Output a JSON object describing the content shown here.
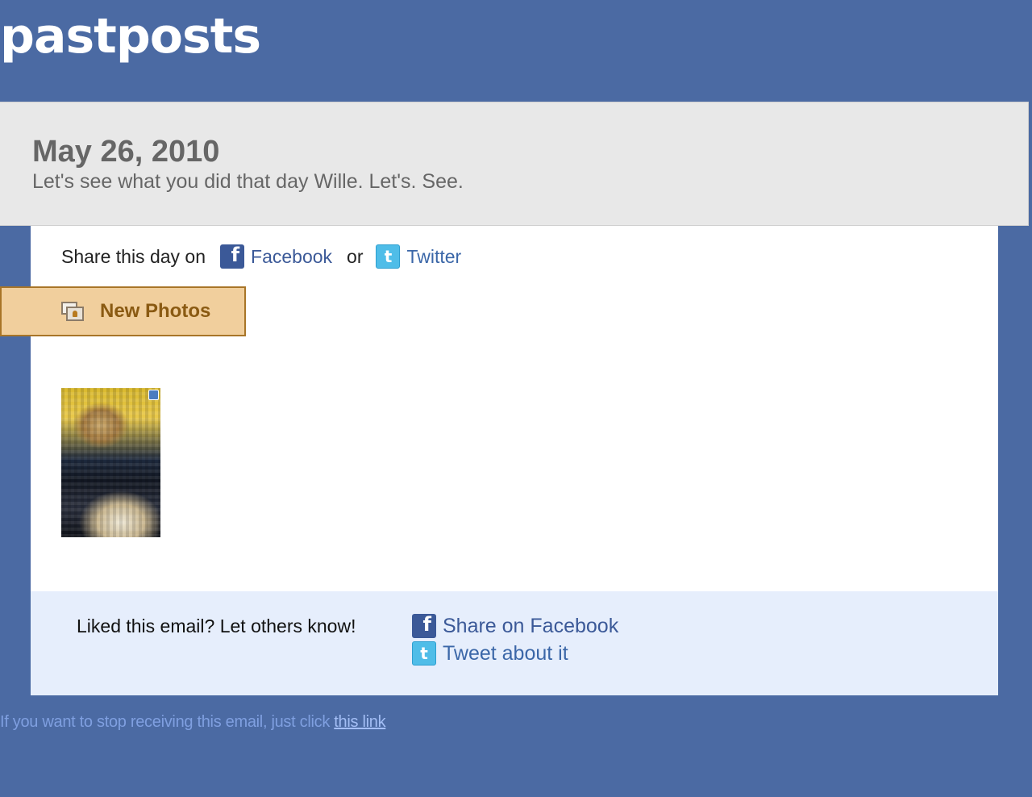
{
  "header": {
    "brand": "pastposts"
  },
  "date_band": {
    "date": "May 26, 2010",
    "subtitle": "Let's see what you did that day Wille. Let's. See."
  },
  "share_row": {
    "prefix": "Share this day on",
    "facebook_label": "Facebook",
    "or_label": "or",
    "twitter_label": "Twitter"
  },
  "photos_tab": {
    "label": "New Photos"
  },
  "footer_box": {
    "liked_text": "Liked this email? Let others know!",
    "share_facebook_label": "Share on Facebook",
    "tweet_label": "Tweet about it"
  },
  "unsubscribe": {
    "text": "If you want to stop receiving this email, just click",
    "link_label": "this link"
  },
  "icons": {
    "facebook_glyph": "f",
    "twitter_glyph": "t"
  },
  "colors": {
    "page_background": "#4b6aa3",
    "band_background": "#e8e8e8",
    "tab_background": "#f1cf9d",
    "tab_border": "#a87528",
    "footer_background": "#e6eefc",
    "facebook_blue": "#3b5998",
    "twitter_blue": "#4fbde8"
  }
}
